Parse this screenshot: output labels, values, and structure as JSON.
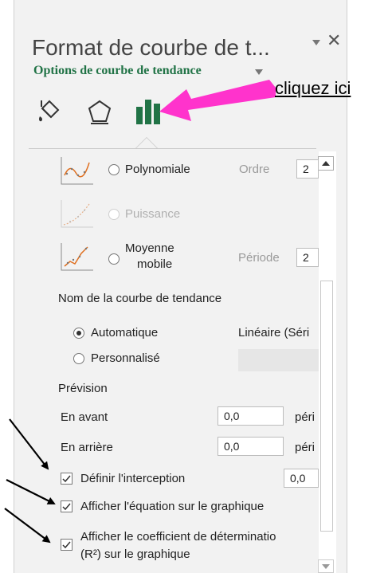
{
  "pane": {
    "title": "Format de courbe de t...",
    "section_title": "Options de courbe de tendance"
  },
  "callout": {
    "text": "cliquez ici"
  },
  "types": [
    {
      "label": "Polynomiale",
      "param_label": "Ordre",
      "param_value": "2"
    },
    {
      "label": "Puissance"
    },
    {
      "label_line1": "Moyenne",
      "label_line2": "mobile",
      "param_label": "Période",
      "param_value": "2"
    }
  ],
  "name": {
    "heading": "Nom de la courbe de tendance",
    "auto_label": "Automatique",
    "auto_value": "Linéaire (Séri",
    "custom_label": "Personnalisé"
  },
  "forecast": {
    "heading": "Prévision",
    "forward_label": "En avant",
    "forward_value": "0,0",
    "forward_unit": "péri",
    "backward_label": "En arrière",
    "backward_value": "0,0",
    "backward_unit": "péri"
  },
  "options": {
    "intercept_label": "Définir l'interception",
    "intercept_value": "0,0",
    "equation_label": "Afficher l'équation sur le graphique",
    "r2_label_line1": "Afficher le coefficient de déterminatio",
    "r2_label_line2": "(R²) sur le graphique"
  },
  "colors": {
    "accent": "#217346",
    "arrow": "#ff33cc",
    "title": "#444444"
  },
  "icons": [
    "paint-bucket-icon",
    "pentagon-icon",
    "bar-chart-icon",
    "dropdown-arrow-icon",
    "close-icon"
  ]
}
